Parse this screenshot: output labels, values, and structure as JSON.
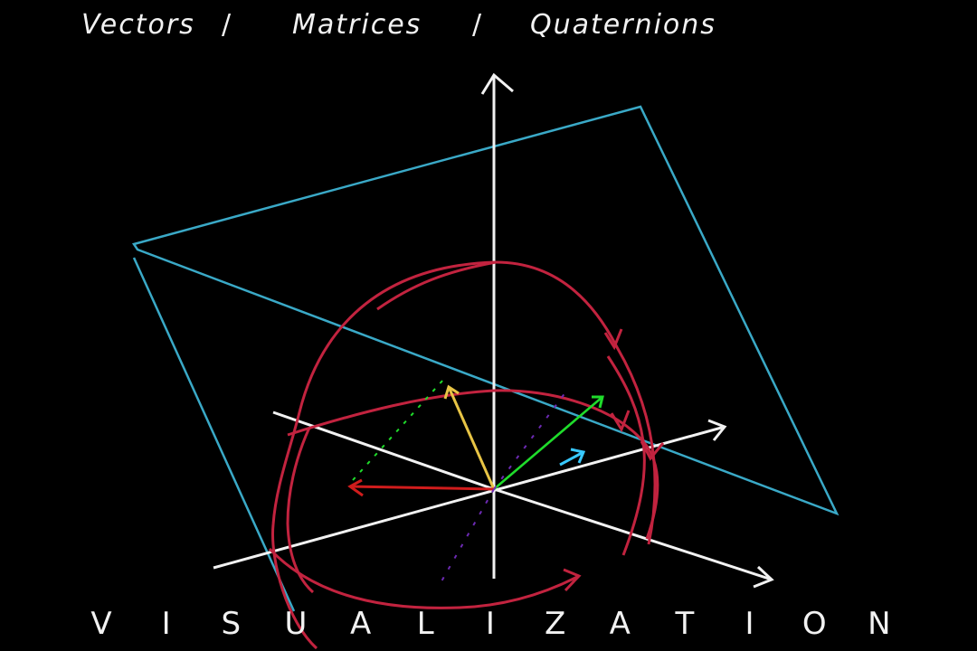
{
  "header": {
    "vectors": "Vectors",
    "sep1": "/",
    "matrices": "Matrices",
    "sep2": "/",
    "quaternions": "Quaternions"
  },
  "footer": {
    "letters": [
      "V",
      "I",
      "S",
      "U",
      "A",
      "L",
      "I",
      "Z",
      "A",
      "T",
      "I",
      "O",
      "N"
    ]
  },
  "colors": {
    "background": "#000000",
    "axes": "#f2f2f2",
    "plane": "#3aa9c7",
    "rotation": "#c2233f",
    "yellow_vector": "#e7c445",
    "green_vector": "#1fdc2b",
    "cyan_vector": "#38c9ff",
    "red_vector": "#d01c1c",
    "purple_dash": "#6c2ab3"
  },
  "icons": [
    "arrowhead-icon"
  ]
}
